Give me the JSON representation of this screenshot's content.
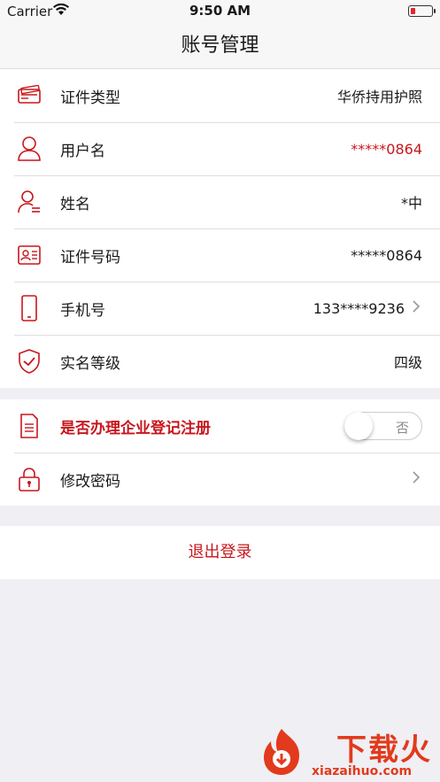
{
  "status": {
    "carrier": "Carrier",
    "time": "9:50 AM"
  },
  "nav": {
    "title": "账号管理"
  },
  "rows": [
    {
      "label": "证件类型",
      "value": "华侨持用护照"
    },
    {
      "label": "用户名",
      "value": "*****0864"
    },
    {
      "label": "姓名",
      "value": "*中"
    },
    {
      "label": "证件号码",
      "value": "*****0864"
    },
    {
      "label": "手机号",
      "value": "133****9236"
    },
    {
      "label": "实名等级",
      "value": "四级"
    }
  ],
  "enterprise": {
    "label": "是否办理企业登记注册",
    "toggle_text": "否",
    "toggle_on": false
  },
  "password": {
    "label": "修改密码"
  },
  "logout": {
    "label": "退出登录"
  },
  "watermark": {
    "brand": "下载火",
    "url": "xiazaihuo.com"
  },
  "colors": {
    "accent": "#c8161d",
    "background": "#efeff4"
  }
}
